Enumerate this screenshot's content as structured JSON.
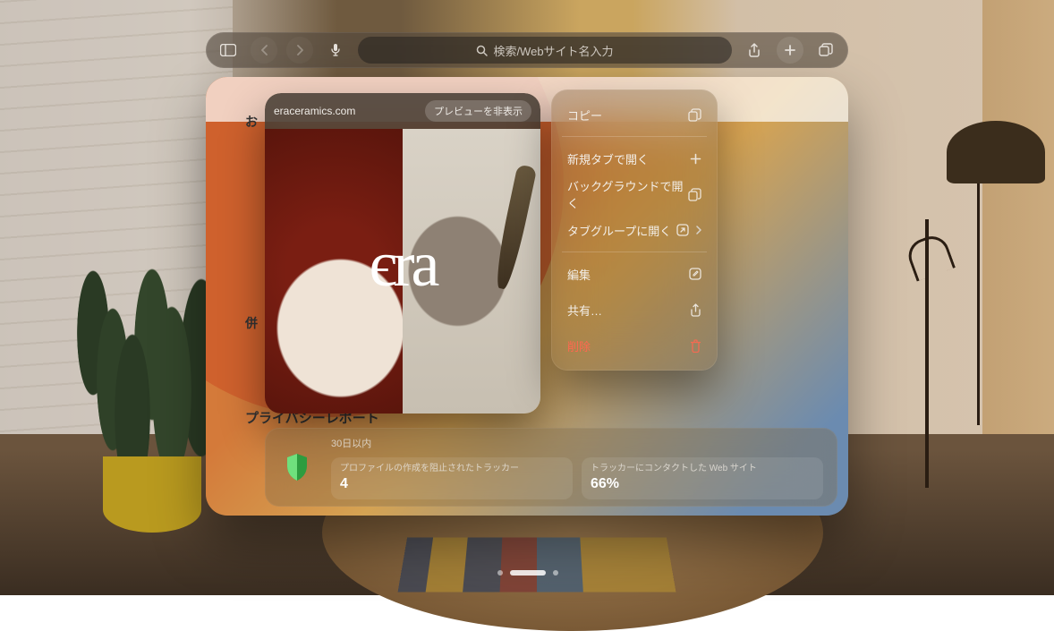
{
  "toolbar": {
    "search_placeholder": "検索/Webサイト名入力"
  },
  "start_page": {
    "favorites_sidecut_label": "お",
    "side_char": "併",
    "privacy_report_label": "プライバシーレポート"
  },
  "preview": {
    "url": "eraceramics.com",
    "hide_preview_label": "プレビューを非表示",
    "logo_text": "єra"
  },
  "context_menu": {
    "copy": "コピー",
    "open_new_tab": "新規タブで開く",
    "open_background": "バックグラウンドで開く",
    "open_in_tab_group": "タブグループに開く",
    "edit": "編集",
    "share": "共有…",
    "delete": "削除"
  },
  "privacy": {
    "period_label": "30日以内",
    "stat1_label": "プロファイルの作成を阻止されたトラッカー",
    "stat1_value": "4",
    "stat2_label": "トラッカーにコンタクトした Web サイト",
    "stat2_value": "66%"
  }
}
